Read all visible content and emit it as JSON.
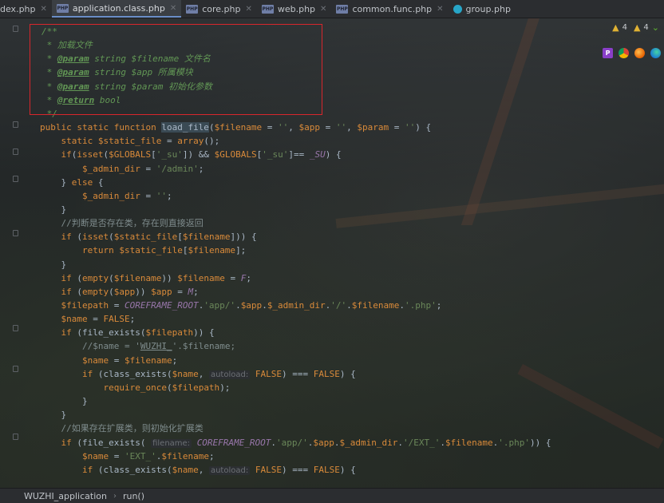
{
  "tabs": [
    {
      "label": "dex.php",
      "active": false,
      "icon": "php-file-icon"
    },
    {
      "label": "application.class.php",
      "active": true,
      "icon": "php-file-icon"
    },
    {
      "label": "core.php",
      "active": false,
      "icon": "php-file-icon"
    },
    {
      "label": "web.php",
      "active": false,
      "icon": "php-file-icon"
    },
    {
      "label": "common.func.php",
      "active": false,
      "icon": "php-file-icon"
    },
    {
      "label": "group.php",
      "active": false,
      "icon": "php-class-icon"
    }
  ],
  "file_icon_text": "PHP",
  "inspections": {
    "warnings_a": "4",
    "warnings_b": "4"
  },
  "code_lines": [
    [
      {
        "t": "/**",
        "c": "doc"
      }
    ],
    [
      {
        "t": " * 加载文件",
        "c": "doc"
      }
    ],
    [
      {
        "t": " * ",
        "c": "doc"
      },
      {
        "t": "@param",
        "c": "tag"
      },
      {
        "t": " string ",
        "c": "doc"
      },
      {
        "t": "$filename",
        "c": "doc"
      },
      {
        "t": " 文件名",
        "c": "doc"
      }
    ],
    [
      {
        "t": " * ",
        "c": "doc"
      },
      {
        "t": "@param",
        "c": "tag"
      },
      {
        "t": " string ",
        "c": "doc"
      },
      {
        "t": "$app",
        "c": "doc"
      },
      {
        "t": " 所属模块",
        "c": "doc"
      }
    ],
    [
      {
        "t": " * ",
        "c": "doc"
      },
      {
        "t": "@param",
        "c": "tag"
      },
      {
        "t": " string ",
        "c": "doc"
      },
      {
        "t": "$param",
        "c": "doc"
      },
      {
        "t": " 初始化参数",
        "c": "doc"
      }
    ],
    [
      {
        "t": " * ",
        "c": "doc"
      },
      {
        "t": "@return",
        "c": "tag"
      },
      {
        "t": " bool",
        "c": "doc"
      }
    ],
    [
      {
        "t": " */",
        "c": "doc"
      }
    ],
    [
      {
        "t": "public static function ",
        "c": "kw"
      },
      {
        "t": "load_file",
        "c": "hl"
      },
      {
        "t": "(",
        "c": ""
      },
      {
        "t": "$filename",
        "c": "var"
      },
      {
        "t": " = ",
        "c": ""
      },
      {
        "t": "''",
        "c": "str"
      },
      {
        "t": ", ",
        "c": ""
      },
      {
        "t": "$app",
        "c": "var"
      },
      {
        "t": " = ",
        "c": ""
      },
      {
        "t": "''",
        "c": "str"
      },
      {
        "t": ", ",
        "c": ""
      },
      {
        "t": "$param",
        "c": "var"
      },
      {
        "t": " = ",
        "c": ""
      },
      {
        "t": "''",
        "c": "str"
      },
      {
        "t": ") {",
        "c": ""
      }
    ],
    [
      {
        "t": "    static ",
        "c": "kw"
      },
      {
        "t": "$static_file",
        "c": "var"
      },
      {
        "t": " = ",
        "c": ""
      },
      {
        "t": "array",
        "c": "kw"
      },
      {
        "t": "();",
        "c": ""
      }
    ],
    [
      {
        "t": "    if",
        "c": "kw"
      },
      {
        "t": "(",
        "c": ""
      },
      {
        "t": "isset",
        "c": "kw"
      },
      {
        "t": "(",
        "c": ""
      },
      {
        "t": "$GLOBALS",
        "c": "var"
      },
      {
        "t": "[",
        "c": ""
      },
      {
        "t": "'_su'",
        "c": "str"
      },
      {
        "t": "]) && ",
        "c": ""
      },
      {
        "t": "$GLOBALS",
        "c": "var"
      },
      {
        "t": "[",
        "c": ""
      },
      {
        "t": "'_su'",
        "c": "str"
      },
      {
        "t": "]== ",
        "c": ""
      },
      {
        "t": "_SU",
        "c": "const"
      },
      {
        "t": ") {",
        "c": ""
      }
    ],
    [
      {
        "t": "        $_admin_dir",
        "c": "var"
      },
      {
        "t": " = ",
        "c": ""
      },
      {
        "t": "'/admin'",
        "c": "str"
      },
      {
        "t": ";",
        "c": ""
      }
    ],
    [
      {
        "t": "    } ",
        "c": ""
      },
      {
        "t": "else",
        "c": "kw"
      },
      {
        "t": " {",
        "c": ""
      }
    ],
    [
      {
        "t": "        $_admin_dir",
        "c": "var"
      },
      {
        "t": " = ",
        "c": ""
      },
      {
        "t": "''",
        "c": "str"
      },
      {
        "t": ";",
        "c": ""
      }
    ],
    [
      {
        "t": "    }",
        "c": ""
      }
    ],
    [
      {
        "t": "    //判断是否存在类，存在则直接返回",
        "c": "cmt"
      }
    ],
    [
      {
        "t": "    if ",
        "c": "kw"
      },
      {
        "t": "(",
        "c": ""
      },
      {
        "t": "isset",
        "c": "kw"
      },
      {
        "t": "(",
        "c": ""
      },
      {
        "t": "$static_file",
        "c": "var"
      },
      {
        "t": "[",
        "c": ""
      },
      {
        "t": "$filename",
        "c": "var"
      },
      {
        "t": "])) {",
        "c": ""
      }
    ],
    [
      {
        "t": "        return ",
        "c": "kw"
      },
      {
        "t": "$static_file",
        "c": "var"
      },
      {
        "t": "[",
        "c": ""
      },
      {
        "t": "$filename",
        "c": "var"
      },
      {
        "t": "];",
        "c": ""
      }
    ],
    [
      {
        "t": "    }",
        "c": ""
      }
    ],
    [
      {
        "t": "    if ",
        "c": "kw"
      },
      {
        "t": "(",
        "c": ""
      },
      {
        "t": "empty",
        "c": "kw"
      },
      {
        "t": "(",
        "c": ""
      },
      {
        "t": "$filename",
        "c": "var"
      },
      {
        "t": ")) ",
        "c": ""
      },
      {
        "t": "$filename",
        "c": "var"
      },
      {
        "t": " = ",
        "c": ""
      },
      {
        "t": "F",
        "c": "const"
      },
      {
        "t": ";",
        "c": ""
      }
    ],
    [
      {
        "t": "    if ",
        "c": "kw"
      },
      {
        "t": "(",
        "c": ""
      },
      {
        "t": "empty",
        "c": "kw"
      },
      {
        "t": "(",
        "c": ""
      },
      {
        "t": "$app",
        "c": "var"
      },
      {
        "t": ")) ",
        "c": ""
      },
      {
        "t": "$app",
        "c": "var"
      },
      {
        "t": " = ",
        "c": ""
      },
      {
        "t": "M",
        "c": "const"
      },
      {
        "t": ";",
        "c": ""
      }
    ],
    [
      {
        "t": "    $filepath",
        "c": "var"
      },
      {
        "t": " = ",
        "c": ""
      },
      {
        "t": "COREFRAME_ROOT",
        "c": "const"
      },
      {
        "t": ".",
        "c": ""
      },
      {
        "t": "'app/'",
        "c": "str"
      },
      {
        "t": ".",
        "c": ""
      },
      {
        "t": "$app",
        "c": "var"
      },
      {
        "t": ".",
        "c": ""
      },
      {
        "t": "$_admin_dir",
        "c": "var"
      },
      {
        "t": ".",
        "c": ""
      },
      {
        "t": "'/'",
        "c": "str"
      },
      {
        "t": ".",
        "c": ""
      },
      {
        "t": "$filename",
        "c": "var"
      },
      {
        "t": ".",
        "c": ""
      },
      {
        "t": "'.php'",
        "c": "str"
      },
      {
        "t": ";",
        "c": ""
      }
    ],
    [
      {
        "t": "    $name",
        "c": "var"
      },
      {
        "t": " = ",
        "c": ""
      },
      {
        "t": "FALSE",
        "c": "kw"
      },
      {
        "t": ";",
        "c": ""
      }
    ],
    [
      {
        "t": "    if ",
        "c": "kw"
      },
      {
        "t": "(",
        "c": ""
      },
      {
        "t": "file_exists",
        "c": ""
      },
      {
        "t": "(",
        "c": ""
      },
      {
        "t": "$filepath",
        "c": "var"
      },
      {
        "t": ")) {",
        "c": ""
      }
    ],
    [
      {
        "t": "        //$name = '",
        "c": "cmt"
      },
      {
        "t": "WUZHI_",
        "c": "cmt underline"
      },
      {
        "t": "'.$filename;",
        "c": "cmt"
      }
    ],
    [
      {
        "t": "        $name",
        "c": "var"
      },
      {
        "t": " = ",
        "c": ""
      },
      {
        "t": "$filename",
        "c": "var"
      },
      {
        "t": ";",
        "c": ""
      }
    ],
    [
      {
        "t": "        if ",
        "c": "kw"
      },
      {
        "t": "(",
        "c": ""
      },
      {
        "t": "class_exists",
        "c": ""
      },
      {
        "t": "(",
        "c": ""
      },
      {
        "t": "$name",
        "c": "var"
      },
      {
        "t": ", ",
        "c": ""
      },
      {
        "t": "autoload:",
        "c": "hint"
      },
      {
        "t": " ",
        "c": ""
      },
      {
        "t": "FALSE",
        "c": "kw"
      },
      {
        "t": ") === ",
        "c": ""
      },
      {
        "t": "FALSE",
        "c": "kw"
      },
      {
        "t": ") {",
        "c": ""
      }
    ],
    [
      {
        "t": "            require_once",
        "c": "kw"
      },
      {
        "t": "(",
        "c": ""
      },
      {
        "t": "$filepath",
        "c": "var"
      },
      {
        "t": ");",
        "c": ""
      }
    ],
    [
      {
        "t": "        }",
        "c": ""
      }
    ],
    [
      {
        "t": "    }",
        "c": ""
      }
    ],
    [
      {
        "t": "    //如果存在扩展类，则初始化扩展类",
        "c": "cmt"
      }
    ],
    [
      {
        "t": "    if ",
        "c": "kw"
      },
      {
        "t": "(",
        "c": ""
      },
      {
        "t": "file_exists",
        "c": ""
      },
      {
        "t": "( ",
        "c": ""
      },
      {
        "t": "filename:",
        "c": "hint"
      },
      {
        "t": " ",
        "c": ""
      },
      {
        "t": "COREFRAME_ROOT",
        "c": "const"
      },
      {
        "t": ".",
        "c": ""
      },
      {
        "t": "'app/'",
        "c": "str"
      },
      {
        "t": ".",
        "c": ""
      },
      {
        "t": "$app",
        "c": "var"
      },
      {
        "t": ".",
        "c": ""
      },
      {
        "t": "$_admin_dir",
        "c": "var"
      },
      {
        "t": ".",
        "c": ""
      },
      {
        "t": "'/EXT_'",
        "c": "str"
      },
      {
        "t": ".",
        "c": ""
      },
      {
        "t": "$filename",
        "c": "var"
      },
      {
        "t": ".",
        "c": ""
      },
      {
        "t": "'.php'",
        "c": "str"
      },
      {
        "t": ")) {",
        "c": ""
      }
    ],
    [
      {
        "t": "        $name",
        "c": "var"
      },
      {
        "t": " = ",
        "c": ""
      },
      {
        "t": "'EXT_'",
        "c": "str"
      },
      {
        "t": ".",
        "c": ""
      },
      {
        "t": "$filename",
        "c": "var"
      },
      {
        "t": ";",
        "c": ""
      }
    ],
    [
      {
        "t": "        if ",
        "c": "kw"
      },
      {
        "t": "(",
        "c": ""
      },
      {
        "t": "class_exists",
        "c": ""
      },
      {
        "t": "(",
        "c": ""
      },
      {
        "t": "$name",
        "c": "var"
      },
      {
        "t": ", ",
        "c": ""
      },
      {
        "t": "autoload:",
        "c": "hint"
      },
      {
        "t": " ",
        "c": ""
      },
      {
        "t": "FALSE",
        "c": "kw"
      },
      {
        "t": ") === ",
        "c": ""
      },
      {
        "t": "FALSE",
        "c": "kw"
      },
      {
        "t": ") {",
        "c": ""
      }
    ]
  ],
  "breadcrumb": {
    "class": "WUZHI_application",
    "method": "run()"
  },
  "colors": {
    "highlight_box": "#d8262c",
    "keyword": "#d98a3a",
    "string": "#6a8759",
    "doc": "#629755"
  }
}
